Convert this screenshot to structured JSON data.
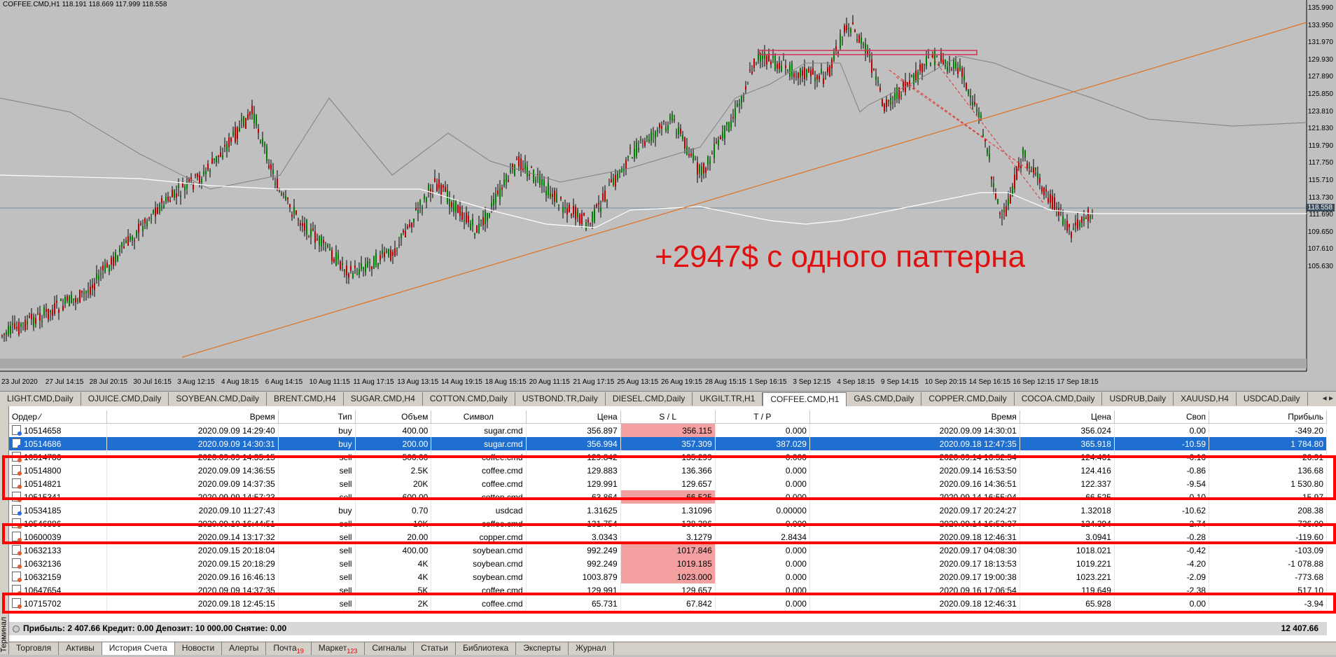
{
  "chart": {
    "title": "COFFEE.CMD,H1  118.191 118.669 117.999 118.558",
    "promo_text": "+2947$ с одного паттерна",
    "current_price": "118.558",
    "price_labels": [
      "135.990",
      "133.950",
      "131.970",
      "129.930",
      "127.890",
      "125.850",
      "123.810",
      "121.830",
      "119.790",
      "117.750",
      "115.710",
      "113.730",
      "111.690",
      "109.650",
      "107.610",
      "105.630"
    ],
    "time_labels": [
      "23 Jul 2020",
      "27 Jul 14:15",
      "28 Jul 20:15",
      "30 Jul 16:15",
      "3 Aug 12:15",
      "4 Aug 18:15",
      "6 Aug 14:15",
      "10 Aug 11:15",
      "11 Aug 17:15",
      "13 Aug 13:15",
      "14 Aug 19:15",
      "18 Aug 15:15",
      "20 Aug 11:15",
      "21 Aug 17:15",
      "25 Aug 13:15",
      "26 Aug 19:15",
      "28 Aug 15:15",
      "1 Sep 16:15",
      "3 Sep 12:15",
      "4 Sep 18:15",
      "9 Sep 14:15",
      "10 Sep 20:15",
      "14 Sep 16:15",
      "16 Sep 12:15",
      "17 Sep 18:15"
    ],
    "colors": {
      "bg": "#c0c0c0",
      "bull": "#008000",
      "bear": "#c00000",
      "trend": "#e07020",
      "promo": "#e01010"
    }
  },
  "chart_tabs": [
    "LIGHT.CMD,Daily",
    "OJUICE.CMD,Daily",
    "SOYBEAN.CMD,Daily",
    "BRENT.CMD,H4",
    "SUGAR.CMD,H4",
    "COTTON.CMD,Daily",
    "USTBOND.TR,Daily",
    "DIESEL.CMD,Daily",
    "UKGILT.TR,H1",
    "COFFEE.CMD,H1",
    "GAS.CMD,Daily",
    "COPPER.CMD,Daily",
    "COCOA.CMD,Daily",
    "USDRUB,Daily",
    "XAUUSD,H4",
    "USDCAD,Daily"
  ],
  "active_chart_tab": "COFFEE.CMD,H1",
  "terminal": {
    "side_label": "Терминал",
    "columns": [
      "Ордер",
      "Время",
      "Тип",
      "Объем",
      "Символ",
      "Цена",
      "S / L",
      "T / P",
      "Время",
      "Цена",
      "Своп",
      "Прибыль"
    ],
    "rows": [
      {
        "order": "10514658",
        "open": "2020.09.09 14:29:40",
        "type": "buy",
        "vol": "400.00",
        "sym": "sugar.cmd",
        "price": "356.897",
        "sl": "356.115",
        "tp": "0.000",
        "close": "2020.09.09 14:30:01",
        "cprice": "356.024",
        "swap": "0.00",
        "profit": "-349.20"
      },
      {
        "order": "10514686",
        "open": "2020.09.09 14:30:31",
        "type": "buy",
        "vol": "200.00",
        "sym": "sugar.cmd",
        "price": "356.994",
        "sl": "357.309",
        "tp": "387.029",
        "close": "2020.09.18 12:47:35",
        "cprice": "365.918",
        "swap": "-10.59",
        "profit": "1 784.80"
      },
      {
        "order": "10514786",
        "open": "2020.09.09 14:35:15",
        "type": "sell",
        "vol": "500.00",
        "sym": "coffee.cmd",
        "price": "129.842",
        "sl": "135.299",
        "tp": "0.000",
        "close": "2020.09.14 16:52:54",
        "cprice": "124.461",
        "swap": "-0.16",
        "profit": "26.91"
      },
      {
        "order": "10514800",
        "open": "2020.09.09 14:36:55",
        "type": "sell",
        "vol": "2.5K",
        "sym": "coffee.cmd",
        "price": "129.883",
        "sl": "136.366",
        "tp": "0.000",
        "close": "2020.09.14 16:53:50",
        "cprice": "124.416",
        "swap": "-0.86",
        "profit": "136.68"
      },
      {
        "order": "10514821",
        "open": "2020.09.09 14:37:35",
        "type": "sell",
        "vol": "20K",
        "sym": "coffee.cmd",
        "price": "129.991",
        "sl": "129.657",
        "tp": "0.000",
        "close": "2020.09.16 14:36:51",
        "cprice": "122.337",
        "swap": "-9.54",
        "profit": "1 530.80"
      },
      {
        "order": "10515341",
        "open": "2020.09.09 14:57:23",
        "type": "sell",
        "vol": "600.00",
        "sym": "cotton.cmd",
        "price": "63.864",
        "sl": "66.525",
        "tp": "0.000",
        "close": "2020.09.14 16:55:04",
        "cprice": "66.525",
        "swap": "-0.10",
        "profit": "-15.97"
      },
      {
        "order": "10534185",
        "open": "2020.09.10 11:27:43",
        "type": "buy",
        "vol": "0.70",
        "sym": "usdcad",
        "price": "1.31625",
        "sl": "1.31096",
        "tp": "0.00000",
        "close": "2020.09.17 20:24:27",
        "cprice": "1.32018",
        "swap": "-10.62",
        "profit": "208.38"
      },
      {
        "order": "10546886",
        "open": "2020.09.10 16:44:51",
        "type": "sell",
        "vol": "10K",
        "sym": "coffee.cmd",
        "price": "131.754",
        "sl": "138.386",
        "tp": "0.000",
        "close": "2020.09.14 16:53:37",
        "cprice": "124.394",
        "swap": "-2.74",
        "profit": "736.00"
      },
      {
        "order": "10600039",
        "open": "2020.09.14 13:17:32",
        "type": "sell",
        "vol": "20.00",
        "sym": "copper.cmd",
        "price": "3.0343",
        "sl": "3.1279",
        "tp": "2.8434",
        "close": "2020.09.18 12:46:31",
        "cprice": "3.0941",
        "swap": "-0.28",
        "profit": "-119.60"
      },
      {
        "order": "10632133",
        "open": "2020.09.15 20:18:04",
        "type": "sell",
        "vol": "400.00",
        "sym": "soybean.cmd",
        "price": "992.249",
        "sl": "1017.846",
        "tp": "0.000",
        "close": "2020.09.17 04:08:30",
        "cprice": "1018.021",
        "swap": "-0.42",
        "profit": "-103.09"
      },
      {
        "order": "10632136",
        "open": "2020.09.15 20:18:29",
        "type": "sell",
        "vol": "4K",
        "sym": "soybean.cmd",
        "price": "992.249",
        "sl": "1019.185",
        "tp": "0.000",
        "close": "2020.09.17 18:13:53",
        "cprice": "1019.221",
        "swap": "-4.20",
        "profit": "-1 078.88"
      },
      {
        "order": "10632159",
        "open": "2020.09.16 16:46:13",
        "type": "sell",
        "vol": "4K",
        "sym": "soybean.cmd",
        "price": "1003.879",
        "sl": "1023.000",
        "tp": "0.000",
        "close": "2020.09.17 19:00:38",
        "cprice": "1023.221",
        "swap": "-2.09",
        "profit": "-773.68"
      },
      {
        "order": "10647654",
        "open": "2020.09.09 14:37:35",
        "type": "sell",
        "vol": "5K",
        "sym": "coffee.cmd",
        "price": "129.991",
        "sl": "129.657",
        "tp": "0.000",
        "close": "2020.09.16 17:06:54",
        "cprice": "119.649",
        "swap": "-2.38",
        "profit": "517.10"
      },
      {
        "order": "10715702",
        "open": "2020.09.18 12:45:15",
        "type": "sell",
        "vol": "2K",
        "sym": "coffee.cmd",
        "price": "65.731",
        "sl": "67.842",
        "tp": "0.000",
        "close": "2020.09.18 12:46:31",
        "cprice": "65.928",
        "swap": "0.00",
        "profit": "-3.94"
      }
    ],
    "summary": "Прибыль: 2 407.66  Кредит: 0.00  Депозит: 10 000.00  Снятие: 0.00",
    "total": "12 407.66"
  },
  "bottom_tabs": [
    {
      "label": "Торговля",
      "badge": ""
    },
    {
      "label": "Активы",
      "badge": ""
    },
    {
      "label": "История Счета",
      "badge": ""
    },
    {
      "label": "Новости",
      "badge": ""
    },
    {
      "label": "Алерты",
      "badge": ""
    },
    {
      "label": "Почта",
      "badge": "19"
    },
    {
      "label": "Маркет",
      "badge": "123"
    },
    {
      "label": "Сигналы",
      "badge": ""
    },
    {
      "label": "Статьи",
      "badge": ""
    },
    {
      "label": "Библиотека",
      "badge": ""
    },
    {
      "label": "Эксперты",
      "badge": ""
    },
    {
      "label": "Журнал",
      "badge": ""
    }
  ],
  "active_bottom_tab": "История Счета"
}
